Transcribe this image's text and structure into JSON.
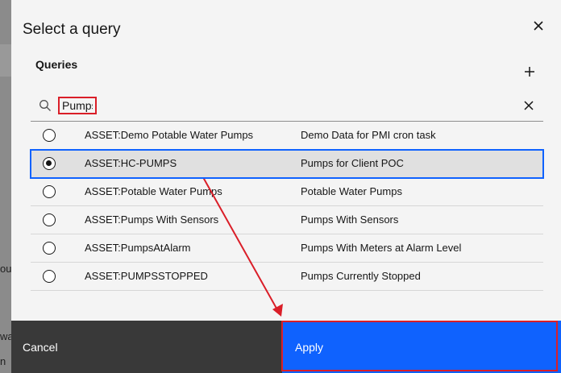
{
  "background": {
    "fragments": [
      "ou",
      "wa",
      "n"
    ]
  },
  "dialog": {
    "title": "Select a query",
    "close_icon": "close-icon",
    "section_label": "Queries",
    "add_icon": "plus-icon",
    "search": {
      "value": "Pumps",
      "search_icon": "search-icon",
      "clear_icon": "close-icon"
    },
    "queries": [
      {
        "name": "ASSET:Demo Potable Water Pumps",
        "description": "Demo Data for PMI cron task",
        "selected": false
      },
      {
        "name": "ASSET:HC-PUMPS",
        "description": "Pumps for Client POC",
        "selected": true
      },
      {
        "name": "ASSET:Potable Water Pumps",
        "description": "Potable Water Pumps",
        "selected": false
      },
      {
        "name": "ASSET:Pumps With Sensors",
        "description": "Pumps With Sensors",
        "selected": false
      },
      {
        "name": "ASSET:PumpsAtAlarm",
        "description": "Pumps With Meters at Alarm Level",
        "selected": false
      },
      {
        "name": "ASSET:PUMPSSTOPPED",
        "description": "Pumps Currently Stopped",
        "selected": false
      }
    ],
    "footer": {
      "cancel_label": "Cancel",
      "apply_label": "Apply"
    }
  },
  "colors": {
    "primary": "#0f62fe",
    "annotation": "#da1e28",
    "secondary_button": "#393939"
  }
}
